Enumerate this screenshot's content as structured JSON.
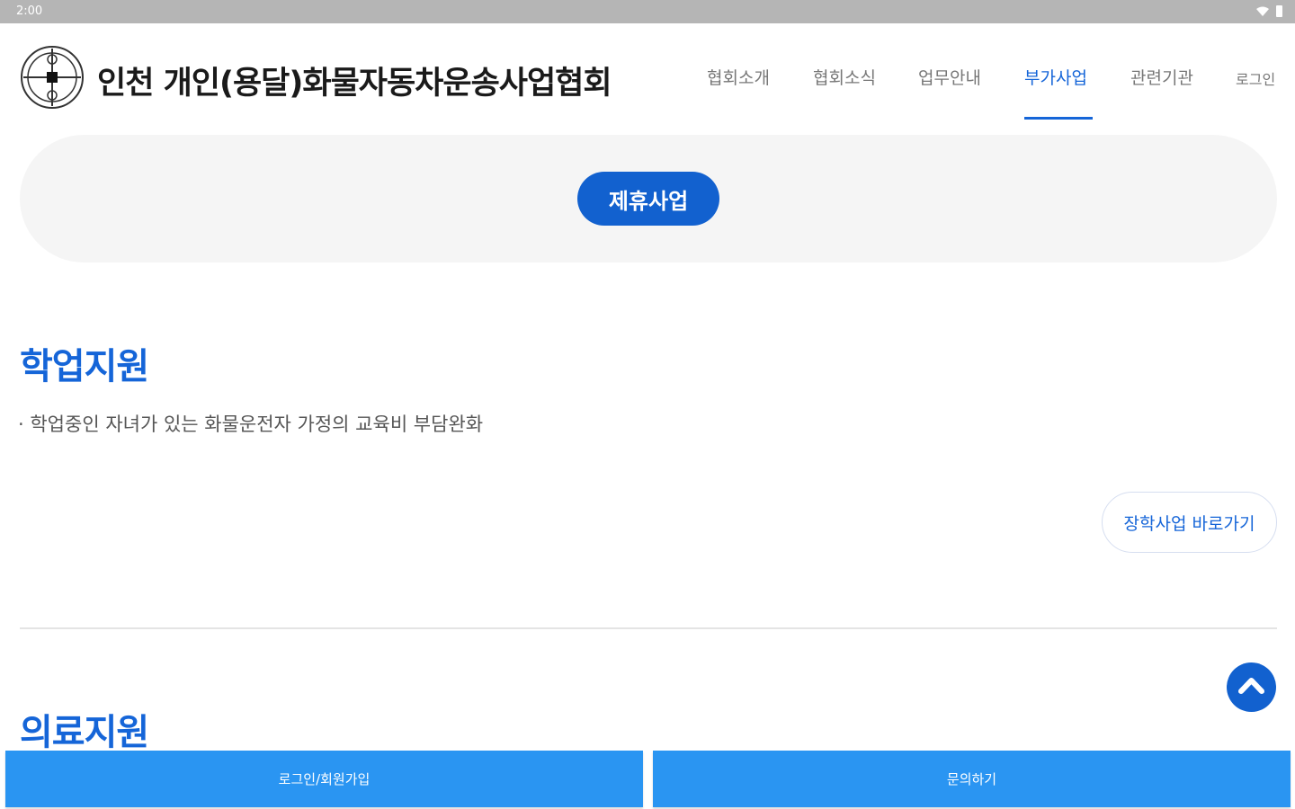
{
  "status_bar": {
    "time": "2:00",
    "icons": [
      "wifi-icon",
      "battery-icon"
    ]
  },
  "header": {
    "org_name": "인천 개인(용달)화물자동차운송사업협회",
    "nav": [
      {
        "label": "협회소개",
        "active": false
      },
      {
        "label": "협회소식",
        "active": false
      },
      {
        "label": "업무안내",
        "active": false
      },
      {
        "label": "부가사업",
        "active": true
      },
      {
        "label": "관련기관",
        "active": false
      },
      {
        "label": "로그인",
        "active": false
      }
    ]
  },
  "hero": {
    "button_label": "제휴사업"
  },
  "sections": [
    {
      "title": "학업지원",
      "bullet": "학업중인 자녀가 있는 화물운전자 가정의 교육비 부담완화",
      "link_label": "장학사업 바로가기"
    },
    {
      "title": "의료지원"
    }
  ],
  "bottom_bar": {
    "left_label": "로그인/회원가입",
    "right_label": "문의하기"
  },
  "colors": {
    "primary": "#1565d8",
    "button": "#1261cf",
    "bottom_bar": "#2a95f2",
    "hero_bg": "#f5f5f5"
  }
}
